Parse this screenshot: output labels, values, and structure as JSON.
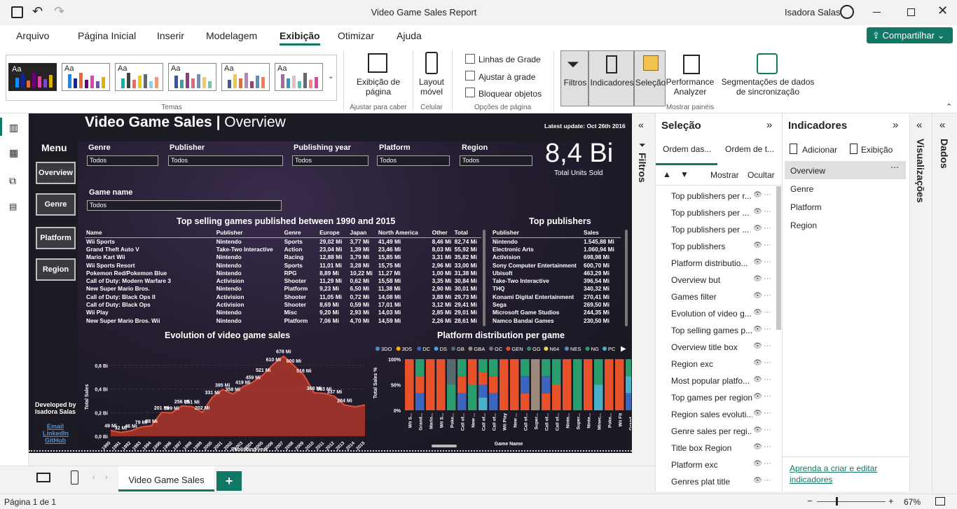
{
  "window": {
    "title": "Video Game Sales Report",
    "user": "Isadora Salas"
  },
  "menu": [
    "Arquivo",
    "Página Inicial",
    "Inserir",
    "Modelagem",
    "Exibição",
    "Otimizar",
    "Ajuda"
  ],
  "share_label": "Compartilhar",
  "ribbon": {
    "themes_label": "Temas",
    "page_view": "Exibição de página",
    "fit_label": "Ajustar para caber",
    "mobile_layout": "Layout móvel",
    "mobile_group": "Celular",
    "gridlines": "Linhas de Grade",
    "snap_grid": "Ajustar à grade",
    "lock_objects": "Bloquear objetos",
    "page_options": "Opções de página",
    "filters": "Filtros",
    "bookmarks": "Indicadores",
    "selection": "Seleção",
    "performance": "Performance Analyzer",
    "sync_slicers": "Segmentações de dados de sincronização",
    "show_panes": "Mostrar painéis"
  },
  "report": {
    "title_bold": "Video Game Sales",
    "title_sep": "|",
    "title_light": "Overview",
    "latest_update": "Latest update: Oct 26th 2016",
    "menu_label": "Menu",
    "menu_buttons": [
      "Overview",
      "Genre",
      "Platform",
      "Region"
    ],
    "slicers": [
      {
        "label": "Genre",
        "value": "Todos"
      },
      {
        "label": "Publisher",
        "value": "Todos"
      },
      {
        "label": "Publishing year",
        "value": "Todos"
      },
      {
        "label": "Platform",
        "value": "Todos"
      },
      {
        "label": "Region",
        "value": "Todos"
      }
    ],
    "game_name": {
      "label": "Game name",
      "value": "Todos"
    },
    "kpi_value": "8,4 Bi",
    "kpi_label": "Total Units Sold",
    "top_games_title": "Top selling games published between 1990 and 2015",
    "top_games_headers": [
      "Name",
      "Publisher",
      "Genre",
      "Europe",
      "Japan",
      "North America",
      "Other",
      "Total"
    ],
    "top_games_rows": [
      [
        "Wii Sports",
        "Nintendo",
        "Sports",
        "29,02 Mi",
        "3,77 Mi",
        "41,49 Mi",
        "8,46 Mi",
        "82,74 Mi"
      ],
      [
        "Grand Theft Auto V",
        "Take-Two Interactive",
        "Action",
        "23,04 Mi",
        "1,39 Mi",
        "23,46 Mi",
        "8,03 Mi",
        "55,92 Mi"
      ],
      [
        "Mario Kart Wii",
        "Nintendo",
        "Racing",
        "12,88 Mi",
        "3,79 Mi",
        "15,85 Mi",
        "3,31 Mi",
        "35,82 Mi"
      ],
      [
        "Wii Sports Resort",
        "Nintendo",
        "Sports",
        "11,01 Mi",
        "3,28 Mi",
        "15,75 Mi",
        "2,96 Mi",
        "33,00 Mi"
      ],
      [
        "Pokemon Red/Pokemon Blue",
        "Nintendo",
        "RPG",
        "8,89 Mi",
        "10,22 Mi",
        "11,27 Mi",
        "1,00 Mi",
        "31,38 Mi"
      ],
      [
        "Call of Duty: Modern Warfare 3",
        "Activision",
        "Shooter",
        "11,29 Mi",
        "0,62 Mi",
        "15,58 Mi",
        "3,35 Mi",
        "30,84 Mi"
      ],
      [
        "New Super Mario Bros.",
        "Nintendo",
        "Platform",
        "9,23 Mi",
        "6,50 Mi",
        "11,38 Mi",
        "2,90 Mi",
        "30,01 Mi"
      ],
      [
        "Call of Duty: Black Ops II",
        "Activision",
        "Shooter",
        "11,05 Mi",
        "0,72 Mi",
        "14,08 Mi",
        "3,88 Mi",
        "29,73 Mi"
      ],
      [
        "Call of Duty: Black Ops",
        "Activision",
        "Shooter",
        "8,69 Mi",
        "0,59 Mi",
        "17,01 Mi",
        "3,12 Mi",
        "29,41 Mi"
      ],
      [
        "Wii Play",
        "Nintendo",
        "Misc",
        "9,20 Mi",
        "2,93 Mi",
        "14,03 Mi",
        "2,85 Mi",
        "29,01 Mi"
      ],
      [
        "New Super Mario Bros. Wii",
        "Nintendo",
        "Platform",
        "7,06 Mi",
        "4,70 Mi",
        "14,59 Mi",
        "2,26 Mi",
        "28,61 Mi"
      ]
    ],
    "top_pub_title": "Top publishers",
    "top_pub_headers": [
      "Publisher",
      "Sales"
    ],
    "top_pub_rows": [
      [
        "Nintendo",
        "1.545,88 Mi"
      ],
      [
        "Electronic Arts",
        "1.060,94 Mi"
      ],
      [
        "Activision",
        "698,98 Mi"
      ],
      [
        "Sony Computer Entertainment",
        "600,70 Mi"
      ],
      [
        "Ubisoft",
        "463,29 Mi"
      ],
      [
        "Take-Two Interactive",
        "396,54 Mi"
      ],
      [
        "THQ",
        "340,32 Mi"
      ],
      [
        "Konami Digital Entertainment",
        "270,41 Mi"
      ],
      [
        "Sega",
        "269,50 Mi"
      ],
      [
        "Microsoft Game Studios",
        "244,35 Mi"
      ],
      [
        "Namco Bandai Games",
        "230,50 Mi"
      ]
    ],
    "developed_by": "Developed by",
    "author": "Isadora Salas",
    "links": [
      "Email",
      "LinkedIn",
      "GitHub"
    ]
  },
  "chart_data": [
    {
      "type": "area",
      "title": "Evolution of video game sales",
      "xlabel": "Publishing year",
      "ylabel": "Total Sales",
      "yticks": [
        "0,0 Bi",
        "0,2 Bi",
        "0,4 Bi",
        "0,6 Bi"
      ],
      "ylim": [
        0,
        0.7
      ],
      "x": [
        "1990",
        "1991",
        "1992",
        "1993",
        "1994",
        "1995",
        "1996",
        "1997",
        "1998",
        "1999",
        "2000",
        "2001",
        "2002",
        "2003",
        "2004",
        "2005",
        "2006",
        "2007",
        "2008",
        "2009",
        "2010",
        "2011",
        "2012",
        "2013",
        "2014",
        "2015"
      ],
      "values": [
        49,
        32,
        46,
        79,
        88,
        201,
        199,
        256,
        251,
        202,
        331,
        395,
        358,
        419,
        459,
        521,
        610,
        678,
        600,
        516,
        368,
        363,
        337,
        264,
        249,
        264
      ],
      "labels": [
        "49 Mi",
        "32 Mi",
        "46 Mi",
        "79 Mi",
        "88 Mi",
        "201 Mi",
        "199 Mi",
        "256 Mi",
        "251 Mi",
        "202 Mi",
        "331 Mi",
        "395 Mi",
        "358 Mi",
        "419 Mi",
        "459 Mi",
        "521 Mi",
        "610 Mi",
        "678 Mi",
        "600 Mi",
        "516 Mi",
        "368 Mi",
        "363 Mi",
        "337 Mi",
        "264 Mi",
        "",
        ""
      ],
      "color": "#c2392b"
    },
    {
      "type": "bar",
      "title": "Platform distribution per game",
      "xlabel": "Game Name",
      "ylabel": "Total Sales %",
      "yticks": [
        "0%",
        "50%",
        "100%"
      ],
      "legend": [
        {
          "name": "3DO",
          "color": "#4a8bc9"
        },
        {
          "name": "3DS",
          "color": "#f2b500"
        },
        {
          "name": "DC",
          "color": "#3c65c0"
        },
        {
          "name": "DS",
          "color": "#4aa3df"
        },
        {
          "name": "GB",
          "color": "#556b6f"
        },
        {
          "name": "GBA",
          "color": "#9b8a7a"
        },
        {
          "name": "GC",
          "color": "#7a6b8a"
        },
        {
          "name": "GEN",
          "color": "#e8522b"
        },
        {
          "name": "GG",
          "color": "#3a8a66"
        },
        {
          "name": "N64",
          "color": "#f0d64a"
        },
        {
          "name": "NES",
          "color": "#5a8fb0"
        },
        {
          "name": "NG",
          "color": "#2a9d6e"
        },
        {
          "name": "PC",
          "color": "#4ab0c8"
        }
      ],
      "categories": [
        "Wii S...",
        "Grand...",
        "Mario...",
        "Wii S...",
        "Poke...",
        "Call of...",
        "New ...",
        "Call of...",
        "Call of...",
        "Wii Play",
        "New ...",
        "Call of...",
        "Super...",
        "Call of...",
        "Call of...",
        "Ninte...",
        "Super...",
        "Ninte...",
        "Minec...",
        "Poke...",
        "Wii Fit",
        "Grand...",
        "Super..."
      ],
      "series_colors": [
        [
          "#e8522b"
        ],
        [
          "#2a9d6e",
          "#e8522b",
          "#3c65c0"
        ],
        [
          "#e8522b"
        ],
        [
          "#e8522b"
        ],
        [
          "#556b6f",
          "#2a9d6e"
        ],
        [
          "#2a9d6e",
          "#e8522b",
          "#3c65c0"
        ],
        [
          "#e8522b",
          "#2a9d6e"
        ],
        [
          "#2a9d6e",
          "#e8522b",
          "#3c65c0",
          "#4ab0c8"
        ],
        [
          "#2a9d6e",
          "#e8522b",
          "#3c65c0"
        ],
        [
          "#e8522b"
        ],
        [
          "#e8522b"
        ],
        [
          "#2a9d6e",
          "#3c65c0",
          "#e8522b"
        ],
        [
          "#9b8a7a"
        ],
        [
          "#2a9d6e",
          "#3c65c0",
          "#e8522b"
        ],
        [
          "#2a9d6e",
          "#e8522b"
        ],
        [
          "#e8522b"
        ],
        [
          "#2a9d6e"
        ],
        [
          "#e8522b"
        ],
        [
          "#2a9d6e",
          "#4ab0c8"
        ],
        [
          "#e8522b"
        ],
        [
          "#e8522b"
        ],
        [
          "#2a9d6e",
          "#4ab0c8",
          "#3c65c0"
        ],
        [
          "#f0d64a",
          "#2a9d6e"
        ]
      ]
    }
  ],
  "selection_pane": {
    "title": "Seleção",
    "tab1": "Ordem das...",
    "tab2": "Ordem de t...",
    "show": "Mostrar",
    "hide": "Ocultar",
    "items": [
      "Top publishers per r...",
      "Top publishers per ...",
      "Top publishers per ...",
      "Top publishers",
      "Platform distributio...",
      "Overview but",
      "Games filter",
      "Evolution of video g...",
      "Top selling games p...",
      "Overview title box",
      "Region exc",
      "Most popular platfo...",
      "Top games per region",
      "Region sales evoluti...",
      "Genre sales per regi...",
      "Title box Region",
      "Platform exc",
      "Genres plat title"
    ]
  },
  "bookmarks_pane": {
    "title": "Indicadores",
    "add": "Adicionar",
    "view": "Exibição",
    "items": [
      "Overview",
      "Genre",
      "Platform",
      "Region"
    ],
    "learn": "Aprenda a criar e editar indicadores"
  },
  "filters_pane": "Filtros",
  "viz_pane": "Visualizações",
  "data_pane": "Dados",
  "page_tab": "Video Game Sales",
  "status": {
    "page": "Página 1 de 1",
    "zoom": "67%"
  }
}
